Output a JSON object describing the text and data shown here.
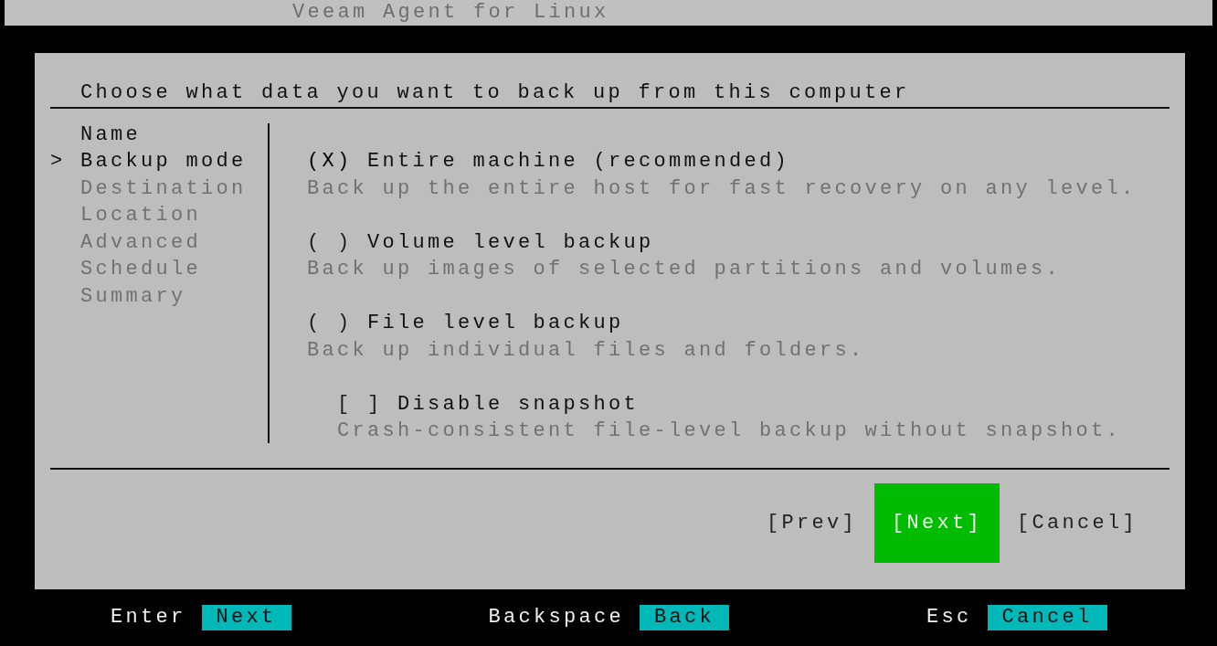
{
  "window": {
    "title": "Veeam Agent for Linux"
  },
  "dialog": {
    "heading": "Choose what data you want to back up from this computer",
    "current_marker": ">",
    "steps": [
      {
        "label": "Name",
        "selected": false,
        "available": true
      },
      {
        "label": "Backup mode",
        "selected": true,
        "available": true
      },
      {
        "label": "Destination",
        "selected": false,
        "available": false
      },
      {
        "label": "Location",
        "selected": false,
        "available": false
      },
      {
        "label": "Advanced",
        "selected": false,
        "available": false
      },
      {
        "label": "Schedule",
        "selected": false,
        "available": false
      },
      {
        "label": "Summary",
        "selected": false,
        "available": false
      }
    ],
    "options": [
      {
        "kind": "radio",
        "selected": true,
        "mark": "(X)",
        "label": "Entire machine (recommended)",
        "description": "Back up the entire host for fast recovery on any level."
      },
      {
        "kind": "radio",
        "selected": false,
        "mark": "( )",
        "label": "Volume level backup",
        "description": "Back up images of selected partitions and volumes."
      },
      {
        "kind": "radio",
        "selected": false,
        "mark": "( )",
        "label": "File level backup",
        "description": "Back up individual files and folders."
      },
      {
        "kind": "checkbox",
        "checked": false,
        "mark": "[ ]",
        "label": "Disable snapshot",
        "description": "Crash-consistent file-level backup without snapshot."
      }
    ],
    "buttons": [
      {
        "label": "[Prev]",
        "selected": false
      },
      {
        "label": "[Next]",
        "selected": true
      },
      {
        "label": "[Cancel]",
        "selected": false
      }
    ]
  },
  "key_hints": [
    {
      "key": "Enter",
      "action": "Next"
    },
    {
      "key": "Backspace",
      "action": "Back"
    },
    {
      "key": "Esc",
      "action": "Cancel"
    }
  ]
}
